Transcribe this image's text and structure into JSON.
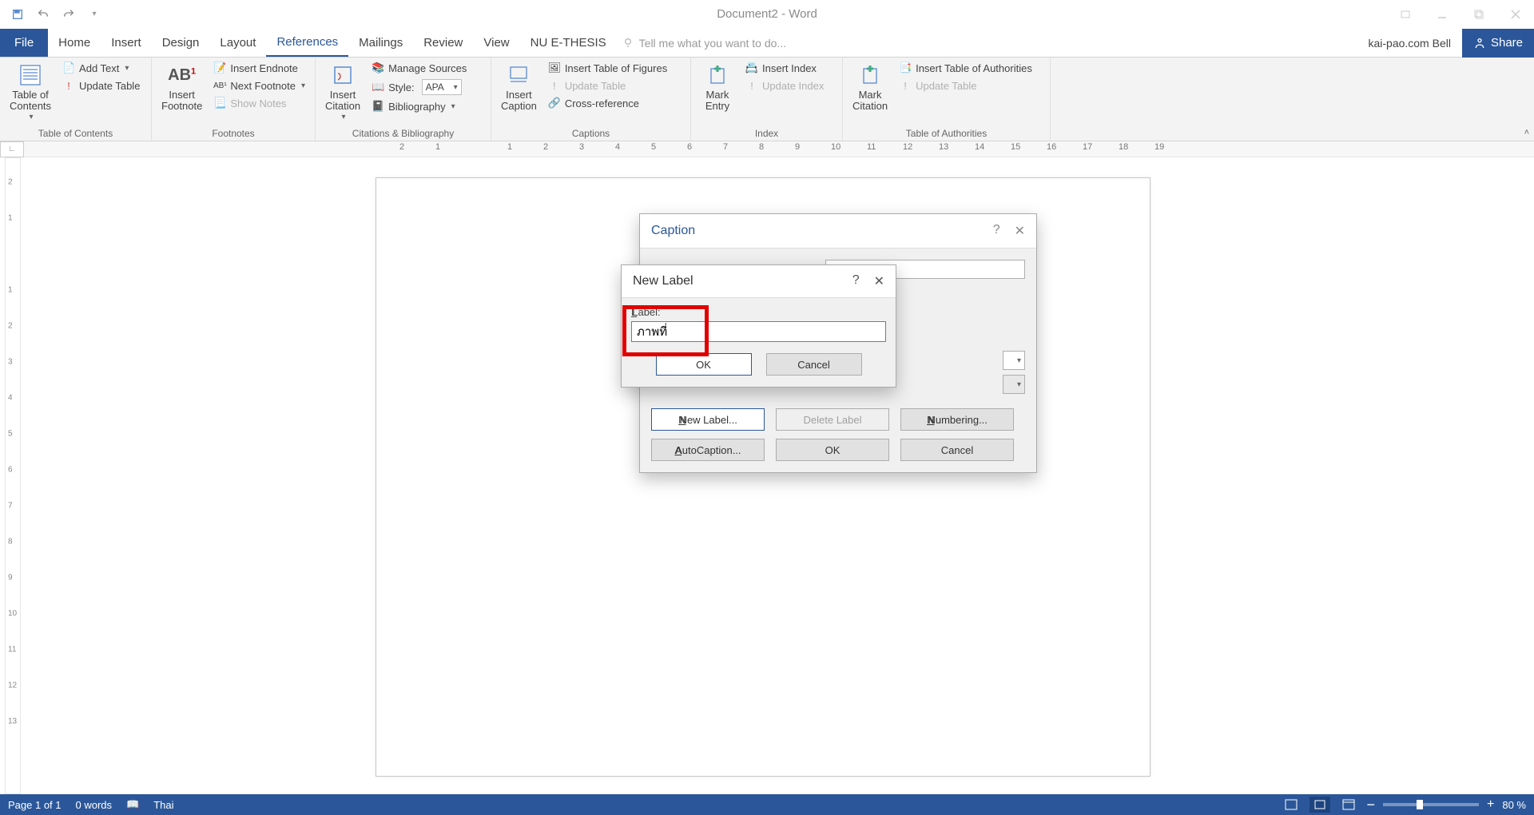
{
  "title": "Document2 - Word",
  "qat": {
    "save": "save-icon",
    "undo": "undo-icon",
    "redo": "redo-icon"
  },
  "tabs": {
    "file": "File",
    "items": [
      "Home",
      "Insert",
      "Design",
      "Layout",
      "References",
      "Mailings",
      "Review",
      "View",
      "NU E-THESIS"
    ],
    "active_index": 4,
    "tellme_placeholder": "Tell me what you want to do..."
  },
  "user": {
    "name": "kai-pao.com Bell",
    "share": "Share"
  },
  "ribbon": {
    "toc": {
      "big": "Table of\nContents",
      "add_text": "Add Text",
      "update_table": "Update Table",
      "group": "Table of Contents"
    },
    "footnotes": {
      "big": "Insert\nFootnote",
      "insert_endnote": "Insert Endnote",
      "next_footnote": "Next Footnote",
      "show_notes": "Show Notes",
      "group": "Footnotes"
    },
    "citations": {
      "big": "Insert\nCitation",
      "manage": "Manage Sources",
      "style_label": "Style:",
      "style_value": "APA",
      "bibliography": "Bibliography",
      "group": "Citations & Bibliography"
    },
    "captions": {
      "big": "Insert\nCaption",
      "insert_tof": "Insert Table of Figures",
      "update_table": "Update Table",
      "crossref": "Cross-reference",
      "group": "Captions"
    },
    "index": {
      "big": "Mark\nEntry",
      "insert_index": "Insert Index",
      "update_index": "Update Index",
      "group": "Index"
    },
    "authorities": {
      "big": "Mark\nCitation",
      "insert_toa": "Insert Table of Authorities",
      "update_table": "Update Table",
      "group": "Table of Authorities"
    }
  },
  "ruler": {
    "ticks": [
      "2",
      "1",
      "",
      "1",
      "2",
      "3",
      "4",
      "5",
      "6",
      "7",
      "8",
      "9",
      "10",
      "11",
      "12",
      "13",
      "14",
      "15",
      "16",
      "17",
      "18",
      "19"
    ]
  },
  "vruler": [
    "2",
    "1",
    "",
    "1",
    "2",
    "3",
    "4",
    "5",
    "6",
    "7",
    "8",
    "9",
    "10",
    "11",
    "12",
    "13"
  ],
  "caption_dialog": {
    "title": "Caption",
    "new_label": "New Label...",
    "delete_label": "Delete Label",
    "numbering": "Numbering...",
    "autocaption": "AutoCaption...",
    "ok": "OK",
    "cancel": "Cancel"
  },
  "newlabel_dialog": {
    "title": "New Label",
    "label_text": "Label:",
    "input_value": "ภาพที่",
    "ok": "OK",
    "cancel": "Cancel"
  },
  "statusbar": {
    "page": "Page 1 of 1",
    "words": "0 words",
    "lang": "Thai",
    "zoom": "80 %"
  }
}
